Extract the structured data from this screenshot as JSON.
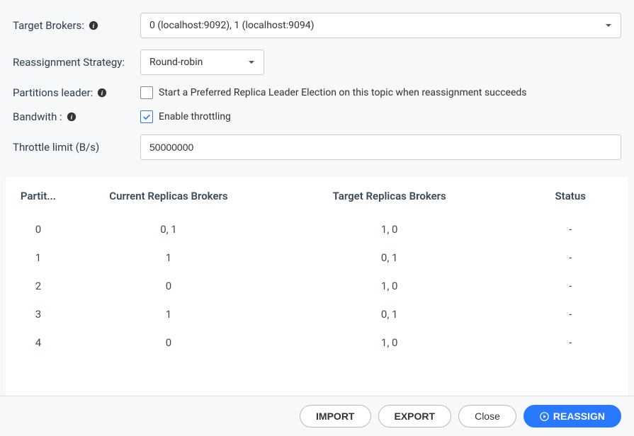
{
  "form": {
    "targetBrokers": {
      "label": "Target Brokers:",
      "value": "0 (localhost:9092), 1 (localhost:9094)"
    },
    "strategy": {
      "label": "Reassignment Strategy:",
      "value": "Round-robin"
    },
    "partitionsLeader": {
      "label": "Partitions leader:",
      "checkboxLabel": "Start a Preferred Replica Leader Election on this topic when reassignment succeeds",
      "checked": false
    },
    "bandwidth": {
      "label": "Bandwith :",
      "checkboxLabel": "Enable throttling",
      "checked": true
    },
    "throttleLimit": {
      "label": "Throttle limit (B/s)",
      "value": "50000000"
    }
  },
  "table": {
    "headers": {
      "partition": "Partit...",
      "current": "Current Replicas Brokers",
      "target": "Target Replicas Brokers",
      "status": "Status"
    },
    "rows": [
      {
        "partition": "0",
        "current": "0, 1",
        "target": "1, 0",
        "status": "-"
      },
      {
        "partition": "1",
        "current": "1",
        "target": "0, 1",
        "status": "-"
      },
      {
        "partition": "2",
        "current": "0",
        "target": "1, 0",
        "status": "-"
      },
      {
        "partition": "3",
        "current": "1",
        "target": "0, 1",
        "status": "-"
      },
      {
        "partition": "4",
        "current": "0",
        "target": "1, 0",
        "status": "-"
      }
    ]
  },
  "footer": {
    "import": "IMPORT",
    "export": "EXPORT",
    "close": "Close",
    "reassign": "REASSIGN"
  }
}
